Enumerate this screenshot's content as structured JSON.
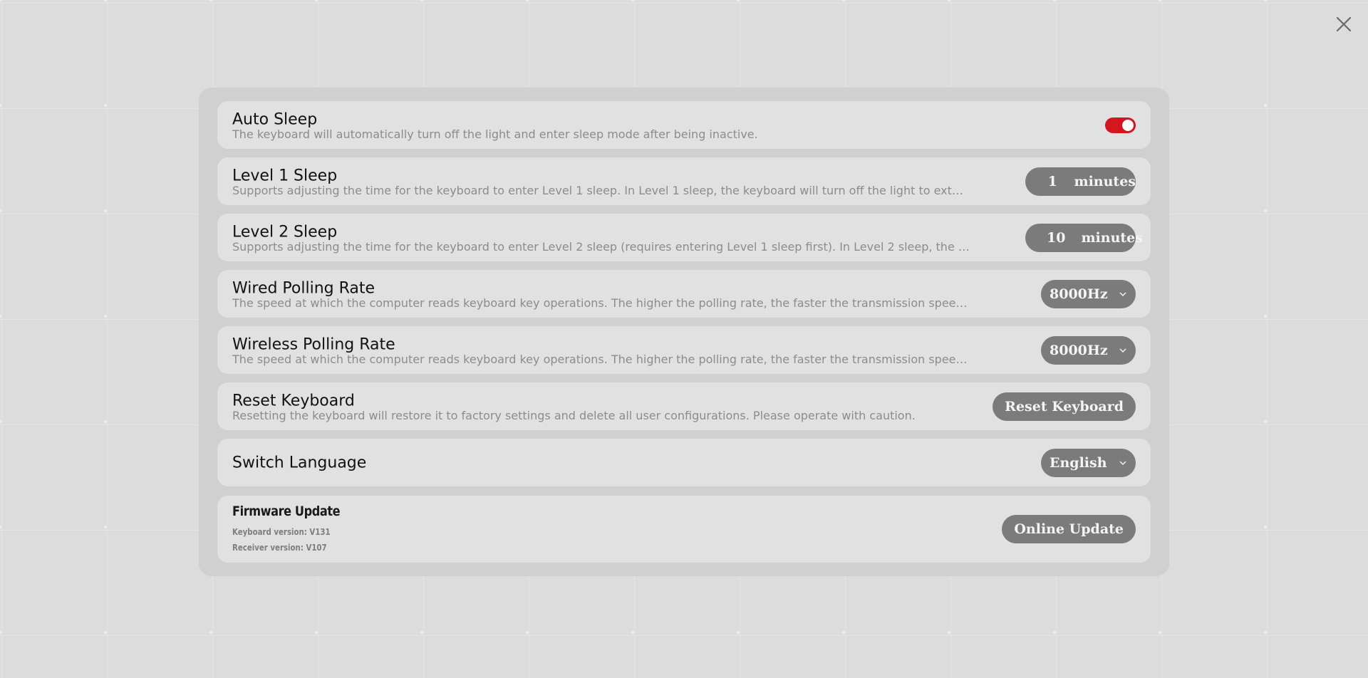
{
  "window": {
    "close_icon": "close-icon"
  },
  "settings": {
    "auto_sleep": {
      "title": "Auto Sleep",
      "description": "The keyboard will automatically turn off the light and enter sleep mode after being inactive.",
      "enabled": true
    },
    "level1_sleep": {
      "title": "Level 1 Sleep",
      "description": "Supports adjusting the time for the keyboard to enter Level 1 sleep. In Level 1 sleep, the keyboard will turn off the light to ext…",
      "value": "1",
      "unit": "minutes"
    },
    "level2_sleep": {
      "title": "Level 2 Sleep",
      "description": "Supports adjusting the time for the keyboard to enter Level 2 sleep (requires entering Level 1 sleep first). In Level 2 sleep, the …",
      "value": "10",
      "unit": "minutes"
    },
    "wired_polling": {
      "title": "Wired Polling Rate",
      "description": "The speed at which the computer reads keyboard key operations. The higher the polling rate, the faster the transmission spee…",
      "selected": "8000Hz"
    },
    "wireless_polling": {
      "title": "Wireless Polling Rate",
      "description": "The speed at which the computer reads keyboard key operations. The higher the polling rate, the faster the transmission spee…",
      "selected": "8000Hz"
    },
    "reset_keyboard": {
      "title": "Reset Keyboard",
      "description": "Resetting the keyboard will restore it to factory settings and delete all user configurations. Please operate with caution.",
      "button_label": "Reset Keyboard"
    },
    "switch_language": {
      "title": "Switch Language",
      "selected": "English"
    },
    "firmware_update": {
      "title": "Firmware Update",
      "keyboard_version": "Keyboard version: V131",
      "receiver_version": "Receiver version: V107",
      "button_label": "Online Update"
    }
  },
  "colors": {
    "toggle_on": "#d4161e",
    "pill_bg": "#7b7b7b",
    "row_bg": "#e1e1e1",
    "panel_bg": "#d0d0d0"
  }
}
